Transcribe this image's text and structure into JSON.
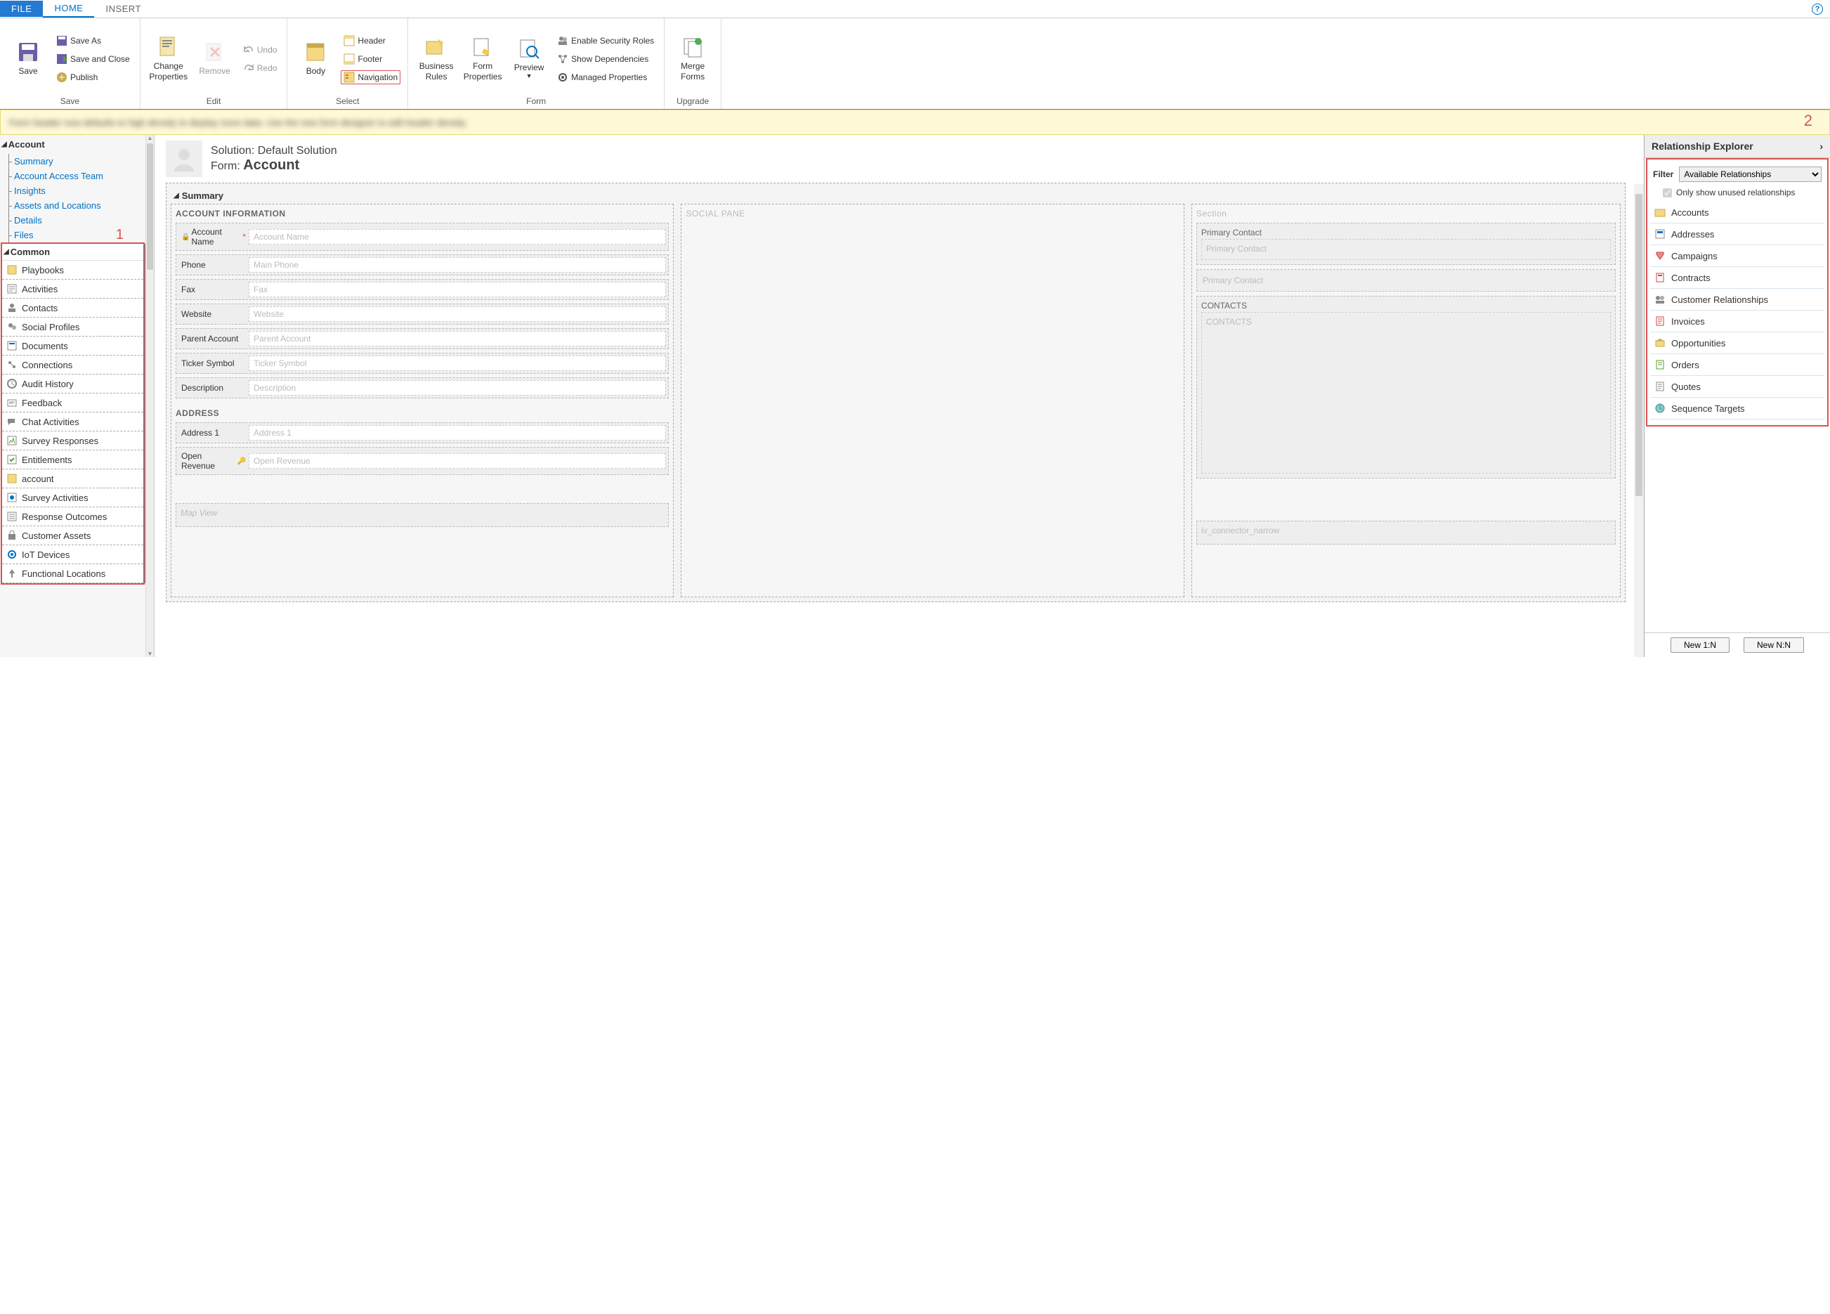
{
  "tabs": {
    "file": "FILE",
    "home": "HOME",
    "insert": "INSERT"
  },
  "ribbon": {
    "save": {
      "save": "Save",
      "save_as": "Save As",
      "save_close": "Save and Close",
      "publish": "Publish",
      "group": "Save"
    },
    "edit": {
      "change_props": "Change\nProperties",
      "remove": "Remove",
      "undo": "Undo",
      "redo": "Redo",
      "group": "Edit"
    },
    "select": {
      "body": "Body",
      "header": "Header",
      "footer": "Footer",
      "navigation": "Navigation",
      "group": "Select"
    },
    "form": {
      "biz_rules": "Business\nRules",
      "form_props": "Form\nProperties",
      "preview": "Preview",
      "security": "Enable Security Roles",
      "deps": "Show Dependencies",
      "managed": "Managed Properties",
      "group": "Form"
    },
    "upgrade": {
      "merge": "Merge\nForms",
      "group": "Upgrade"
    }
  },
  "notice": "Form header now defaults to high density to display more data. Use the new form designer to edit header density.",
  "tree": {
    "account_hdr": "Account",
    "items": [
      "Summary",
      "Account Access Team",
      "Insights",
      "Assets and Locations",
      "Details",
      "Files"
    ]
  },
  "common": {
    "hdr": "Common",
    "items": [
      "Playbooks",
      "Activities",
      "Contacts",
      "Social Profiles",
      "Documents",
      "Connections",
      "Audit History",
      "Feedback",
      "Chat Activities",
      "Survey Responses",
      "Entitlements",
      "account",
      "Survey Activities",
      "Response Outcomes",
      "Customer Assets",
      "IoT Devices",
      "Functional Locations"
    ]
  },
  "annot": {
    "one": "1",
    "two": "2"
  },
  "form_meta": {
    "solution_lbl": "Solution: ",
    "solution_val": "Default Solution",
    "form_lbl": "Form: ",
    "form_val": "Account"
  },
  "summary": {
    "title": "Summary",
    "col1": {
      "hdr": "ACCOUNT INFORMATION",
      "fields": [
        {
          "label": "Account Name",
          "ph": "Account Name",
          "locked": true,
          "req": true
        },
        {
          "label": "Phone",
          "ph": "Main Phone"
        },
        {
          "label": "Fax",
          "ph": "Fax"
        },
        {
          "label": "Website",
          "ph": "Website"
        },
        {
          "label": "Parent Account",
          "ph": "Parent Account"
        },
        {
          "label": "Ticker Symbol",
          "ph": "Ticker Symbol"
        },
        {
          "label": "Description",
          "ph": "Description"
        }
      ],
      "addr_hdr": "ADDRESS",
      "addr": [
        {
          "label": "Address 1",
          "ph": "Address 1"
        },
        {
          "label": "Open Revenue",
          "ph": "Open Revenue",
          "key": true
        }
      ],
      "map": "Map View"
    },
    "col2": {
      "hdr": "SOCIAL PANE"
    },
    "col3": {
      "hdr": "Section",
      "pc_label": "Primary Contact",
      "pc_ph": "Primary Contact",
      "pc2_ph": "Primary Contact",
      "contacts_hdr": "CONTACTS",
      "contacts_ph": "CONTACTS",
      "iv": "iv_connector_narrow"
    }
  },
  "right": {
    "hdr": "Relationship Explorer",
    "filter_lbl": "Filter",
    "filter_val": "Available Relationships",
    "only_unused": "Only show unused relationships",
    "only_unused_checked": true,
    "items": [
      "Accounts",
      "Addresses",
      "Campaigns",
      "Contracts",
      "Customer Relationships",
      "Invoices",
      "Opportunities",
      "Orders",
      "Quotes",
      "Sequence Targets"
    ],
    "new_1n": "New 1:N",
    "new_nn": "New N:N"
  }
}
